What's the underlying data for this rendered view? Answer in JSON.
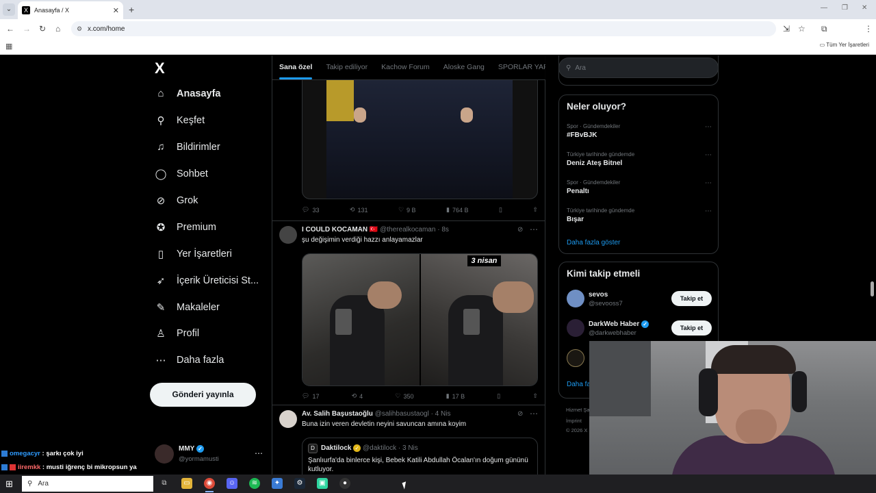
{
  "browser": {
    "tab_title": "Anasayfa / X",
    "tab_favicon": "X",
    "url": "x.com/home",
    "bookmarks_all": "Tüm Yer İşaretleri"
  },
  "sidebar": {
    "logo": "X",
    "items": [
      {
        "label": "Anasayfa",
        "icon": "home-icon",
        "glyph": "⌂"
      },
      {
        "label": "Keşfet",
        "icon": "search-icon",
        "glyph": "⚲"
      },
      {
        "label": "Bildirimler",
        "icon": "bell-icon",
        "glyph": "♫"
      },
      {
        "label": "Sohbet",
        "icon": "chat-icon",
        "glyph": "◯"
      },
      {
        "label": "Grok",
        "icon": "grok-icon",
        "glyph": "⊘"
      },
      {
        "label": "Premium",
        "icon": "verified-icon",
        "glyph": "✪"
      },
      {
        "label": "Yer İşaretleri",
        "icon": "bookmark-icon",
        "glyph": "▯"
      },
      {
        "label": "İçerik Üreticisi St...",
        "icon": "rocket-icon",
        "glyph": "➶"
      },
      {
        "label": "Makaleler",
        "icon": "article-icon",
        "glyph": "✎"
      },
      {
        "label": "Profil",
        "icon": "profile-icon",
        "glyph": "♙"
      },
      {
        "label": "Daha fazla",
        "icon": "more-icon",
        "glyph": "⋯"
      }
    ],
    "post_button": "Gönderi yayınla",
    "account": {
      "name": "MMY",
      "handle": "@yormamusti"
    }
  },
  "feed": {
    "tabs": [
      {
        "label": "Sana özel",
        "active": true
      },
      {
        "label": "Takip ediliyor"
      },
      {
        "label": "Kachow Forum"
      },
      {
        "label": "Aloske Gang"
      },
      {
        "label": "SPORLAR YAP"
      }
    ],
    "tweet0_actions": {
      "replies": "33",
      "reposts": "131",
      "likes": "9 B",
      "views": "764 B"
    },
    "tweet1": {
      "name": "I COULD KOCAMAN",
      "flag": "🇹🇷",
      "handle": "@therealkocaman",
      "time": "· 8s",
      "text": "şu değişimin verdiği hazzı anlayamazlar",
      "overlay": "3 nisan",
      "actions": {
        "replies": "17",
        "reposts": "4",
        "likes": "350",
        "views": "17 B"
      }
    },
    "tweet2": {
      "name": "Av. Salih Başustaoğlu",
      "handle": "@salihbasustaogl",
      "time": "· 4 Nis",
      "text": "Buna izin veren devletin neyini savuncan amına koyim",
      "quote": {
        "name": "Daktilock",
        "handle": "@daktilock",
        "time": "· 3 Nis",
        "text": "Şanlıurfa'da binlerce kişi, Bebek Katili Abdullah Öcalan'ın doğum gününü kutluyor."
      }
    }
  },
  "right": {
    "search_placeholder": "Ara",
    "trends_title": "Neler oluyor?",
    "trends": [
      {
        "category": "Spor · Gündemdekiler",
        "title": "#FBvBJK"
      },
      {
        "category": "Türkiye tarihinde gündemde",
        "title": "Deniz Ateş Bitnel"
      },
      {
        "category": "Spor · Gündemdekiler",
        "title": "Penaltı"
      },
      {
        "category": "Türkiye tarihinde gündemde",
        "title": "Bışar"
      }
    ],
    "show_more": "Daha fazla göster",
    "who_title": "Kimi takip etmeli",
    "who": [
      {
        "name": "sevos",
        "handle": "@sevooss7",
        "color": "#6f8fc4"
      },
      {
        "name": "DarkWeb Haber",
        "handle": "@darkwebhaber",
        "color": "#2a1f35",
        "verified": true
      }
    ],
    "follow_label": "Takip et",
    "who_more": "Daha fa",
    "footer": [
      "Hizmet Şa",
      "İmprint",
      "© 2026 X"
    ]
  },
  "chat": [
    {
      "user": "omegacyr",
      "text": " : şarkı çok iyi"
    },
    {
      "user": "iiremkk",
      "text": " : musti iğrenç bi mikropsun ya"
    }
  ],
  "taskbar": {
    "search_label": "Ara"
  },
  "colors": {
    "accent": "#1d9bf0",
    "background": "#000000",
    "muted": "#71767b"
  }
}
